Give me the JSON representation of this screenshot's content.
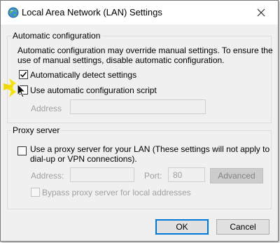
{
  "window": {
    "title": "Local Area Network (LAN) Settings",
    "icon": "network-globe-icon",
    "close": "close-icon"
  },
  "auto_config": {
    "legend": "Automatic configuration",
    "description_line1": "Automatic configuration may override manual settings.  To ensure the",
    "description_line2": "use of manual settings, disable automatic configuration.",
    "detect_label": "Automatically detect settings",
    "detect_checked": true,
    "script_label": "Use automatic configuration script",
    "script_checked": false,
    "address_label": "Address",
    "address_value": ""
  },
  "proxy": {
    "legend": "Proxy server",
    "use_proxy_line1": "Use a proxy server for your LAN (These settings will not apply to",
    "use_proxy_line2": "dial-up or VPN connections).",
    "use_proxy_checked": false,
    "address_label": "Address:",
    "address_value": "",
    "port_label": "Port:",
    "port_value": "80",
    "advanced_label": "Advanced",
    "bypass_label": "Bypass proxy server for local addresses",
    "bypass_checked": false
  },
  "buttons": {
    "ok": "OK",
    "cancel": "Cancel"
  },
  "colors": {
    "accent": "#0078d7",
    "highlight": "#f5e400"
  }
}
